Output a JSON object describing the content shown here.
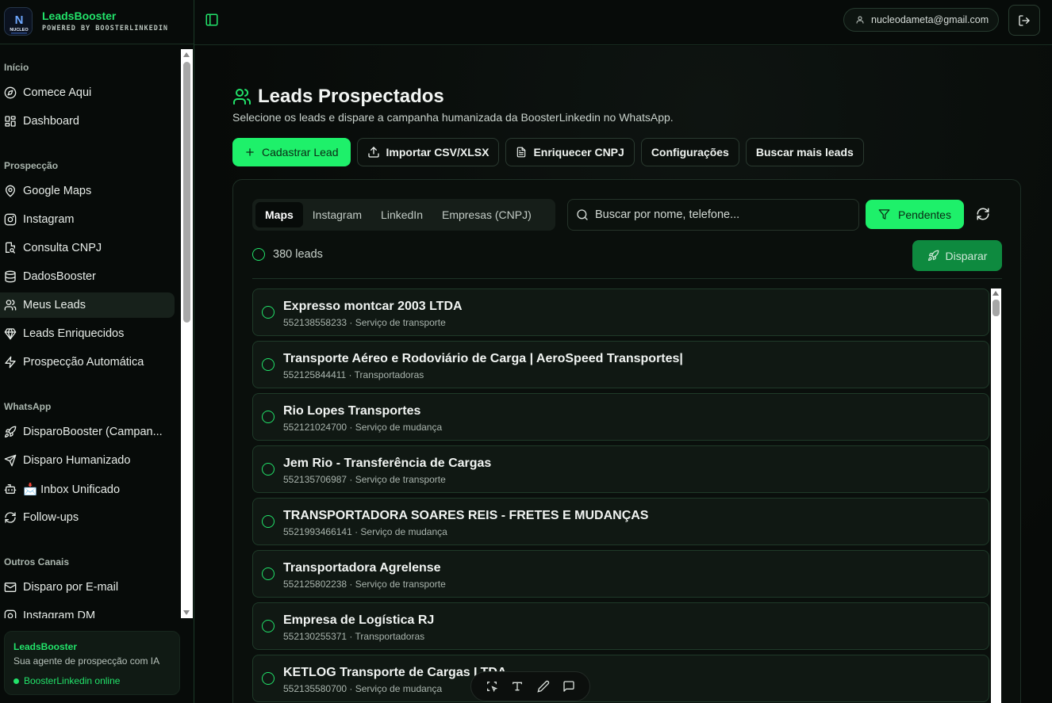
{
  "brand": {
    "title": "LeadsBooster",
    "subtitle": "POWERED BY BOOSTERLINKEDIN",
    "logo_text": "NUCLEO"
  },
  "sidebar": {
    "sections": [
      {
        "label": "Início",
        "items": [
          {
            "label": "Comece Aqui",
            "icon": "compass-icon"
          },
          {
            "label": "Dashboard",
            "icon": "dashboard-grid-icon"
          }
        ]
      },
      {
        "label": "Prospecção",
        "items": [
          {
            "label": "Google Maps",
            "icon": "map-pin-icon"
          },
          {
            "label": "Instagram",
            "icon": "instagram-icon"
          },
          {
            "label": "Consulta CNPJ",
            "icon": "file-search-icon"
          },
          {
            "label": "DadosBooster",
            "icon": "database-icon"
          },
          {
            "label": "Meus Leads",
            "icon": "users-icon",
            "active": true
          },
          {
            "label": "Leads Enriquecidos",
            "icon": "gem-icon"
          },
          {
            "label": "Prospecção Automática",
            "icon": "zap-icon"
          }
        ]
      },
      {
        "label": "WhatsApp",
        "items": [
          {
            "label": "DisparoBooster (Campan...",
            "icon": "rocket-icon"
          },
          {
            "label": "Disparo Humanizado",
            "icon": "send-icon"
          },
          {
            "label": "📩 Inbox Unificado",
            "icon": "bot-icon"
          },
          {
            "label": "Follow-ups",
            "icon": "refresh-icon"
          }
        ]
      },
      {
        "label": "Outros Canais",
        "items": [
          {
            "label": "Disparo por E-mail",
            "icon": "mail-icon"
          },
          {
            "label": "Instagram DM",
            "icon": "instagram-icon"
          }
        ]
      }
    ],
    "footer": {
      "title": "LeadsBooster",
      "description": "Sua agente de prospecção com IA",
      "status": "BoosterLinkedin online"
    }
  },
  "header": {
    "user_email": "nucleodameta@gmail.com"
  },
  "main": {
    "title": "Leads Prospectados",
    "description": "Selecione os leads e dispare a campanha humanizada da BoosterLinkedin no WhatsApp.",
    "actions": {
      "add": "Cadastrar Lead",
      "import": "Importar CSV/XLSX",
      "enrich": "Enriquecer CNPJ",
      "settings": "Configurações",
      "more": "Buscar mais leads"
    },
    "tabs": [
      "Maps",
      "Instagram",
      "LinkedIn",
      "Empresas (CNPJ)"
    ],
    "search_placeholder": "Buscar por nome, telefone...",
    "filter_label": "Pendentes",
    "count_label": "380 leads",
    "send_label": "Disparar",
    "leads": [
      {
        "name": "Expresso montcar 2003 LTDA",
        "meta": "552138558233 · Serviço de transporte"
      },
      {
        "name": "Transporte Aéreo e Rodoviário de Carga | AeroSpeed Transportes|",
        "meta": "552125844411 · Transportadoras"
      },
      {
        "name": "Rio Lopes Transportes",
        "meta": "552121024700 · Serviço de mudança"
      },
      {
        "name": "Jem Rio - Transferência de Cargas",
        "meta": "552135706987 · Serviço de transporte"
      },
      {
        "name": "TRANSPORTADORA SOARES REIS - FRETES E MUDANÇAS",
        "meta": "5521993466141 · Serviço de mudança"
      },
      {
        "name": "Transportadora Agrelense",
        "meta": "552125802238 · Serviço de transporte"
      },
      {
        "name": "Empresa de Logística RJ",
        "meta": "552130255371 · Transportadoras"
      },
      {
        "name": "KETLOG Transporte de Cargas LTDA",
        "meta": "552135580700 · Serviço de mudança"
      }
    ]
  },
  "colors": {
    "accent": "#1ef06a",
    "accent_dark": "#0e8a3f",
    "background": "#060a08",
    "card": "#101813"
  }
}
